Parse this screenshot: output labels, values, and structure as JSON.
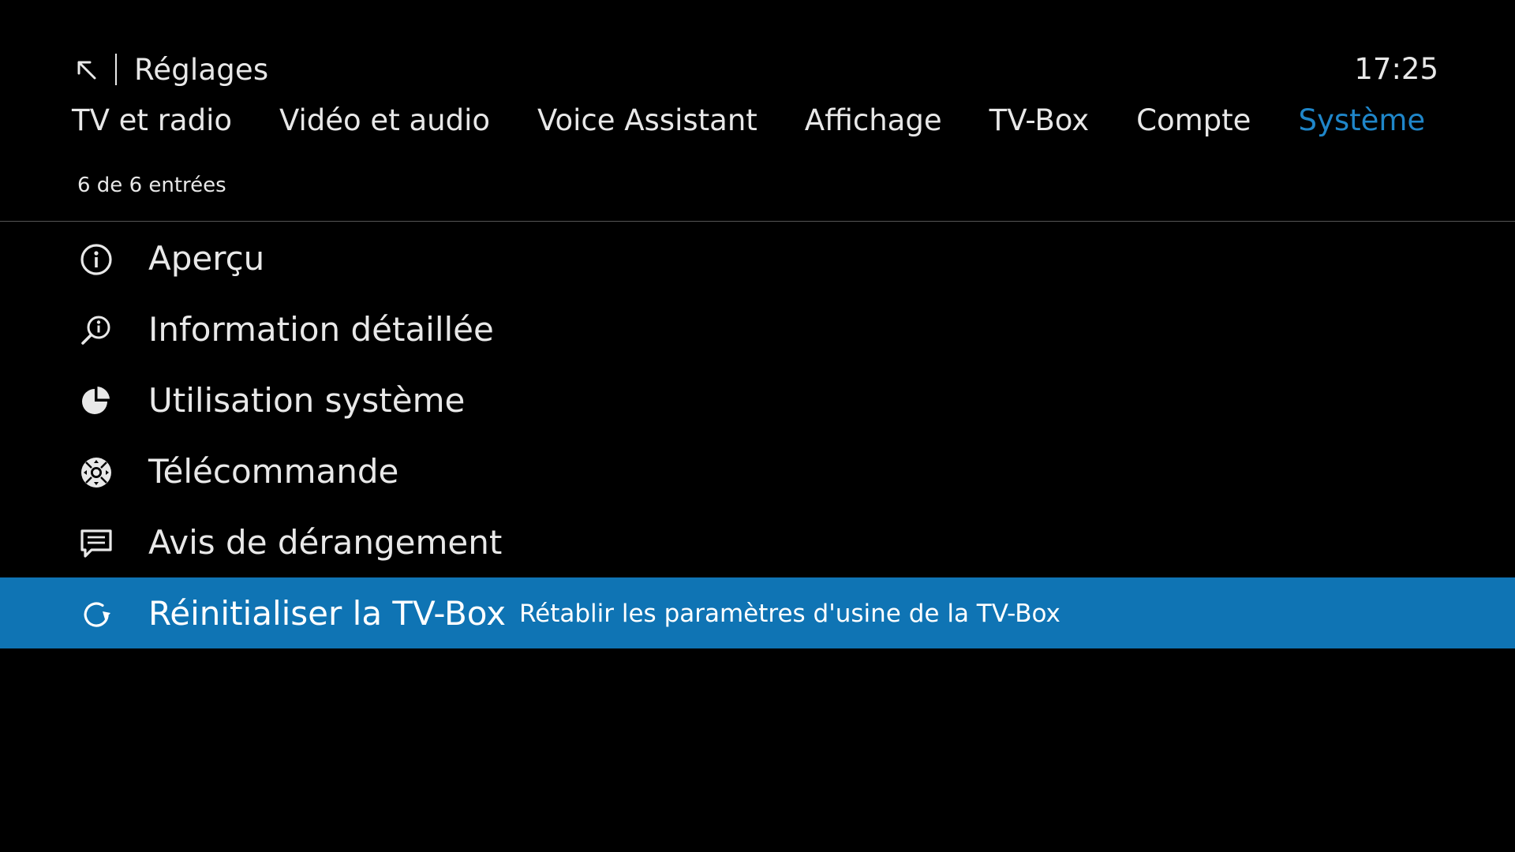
{
  "header": {
    "back_icon": "arrow-up-left-icon",
    "title": "Réglages",
    "clock": "17:25"
  },
  "tabs": [
    {
      "label": "TV et radio",
      "active": false
    },
    {
      "label": "Vidéo et audio",
      "active": false
    },
    {
      "label": "Voice Assistant",
      "active": false
    },
    {
      "label": "Affichage",
      "active": false
    },
    {
      "label": "TV-Box",
      "active": false
    },
    {
      "label": "Compte",
      "active": false
    },
    {
      "label": "Système",
      "active": true
    }
  ],
  "count_text": "6 de 6 entrées",
  "items": [
    {
      "label": "Aperçu",
      "icon": "info-icon",
      "description": "",
      "selected": false
    },
    {
      "label": "Information détaillée",
      "icon": "search-info-icon",
      "description": "",
      "selected": false
    },
    {
      "label": "Utilisation système",
      "icon": "pie-chart-icon",
      "description": "",
      "selected": false
    },
    {
      "label": "Télécommande",
      "icon": "remote-dpad-icon",
      "description": "",
      "selected": false
    },
    {
      "label": "Avis de dérangement",
      "icon": "message-icon",
      "description": "",
      "selected": false
    },
    {
      "label": "Réinitialiser la TV-Box",
      "icon": "refresh-icon",
      "description": "Rétablir les paramètres d'usine de la TV-Box",
      "selected": true
    }
  ],
  "colors": {
    "background": "#000000",
    "text": "#e8e8e8",
    "accent_tab": "#1f86c9",
    "selection": "#0f74b4"
  }
}
